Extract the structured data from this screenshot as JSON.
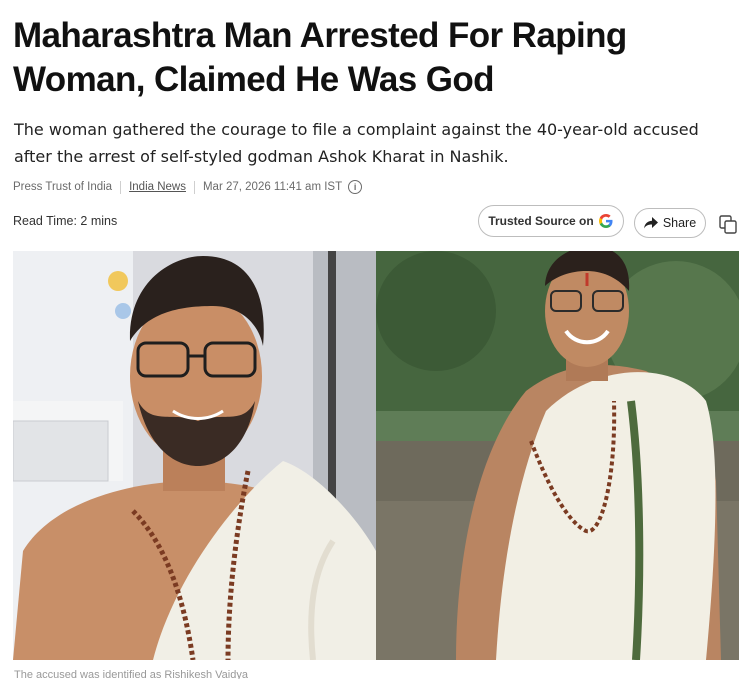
{
  "article": {
    "headline": "Maharashtra Man Arrested For Raping Woman, Claimed He Was God",
    "summary": "The woman gathered the courage to file a complaint against the 40-year-old accused after the arrest of self-styled godman Ashok Kharat in Nashik.",
    "source": "Press Trust of India",
    "category": "India News",
    "timestamp": "Mar 27, 2026 11:41 am IST",
    "read_time_label": "Read Time:",
    "read_time_value": "2 mins",
    "caption": "The accused was identified as Rishikesh Vaidya"
  },
  "actions": {
    "trusted_label": "Trusted Source on",
    "google_letter": "G",
    "share_label": "Share"
  },
  "icons": {
    "info": "info-icon",
    "google": "google-g-icon",
    "share": "share-arrow-icon",
    "copy": "copy-icon"
  },
  "colors": {
    "google_blue": "#4285F4",
    "google_red": "#EA4335",
    "google_yellow": "#FBBC05",
    "google_green": "#34A853"
  }
}
